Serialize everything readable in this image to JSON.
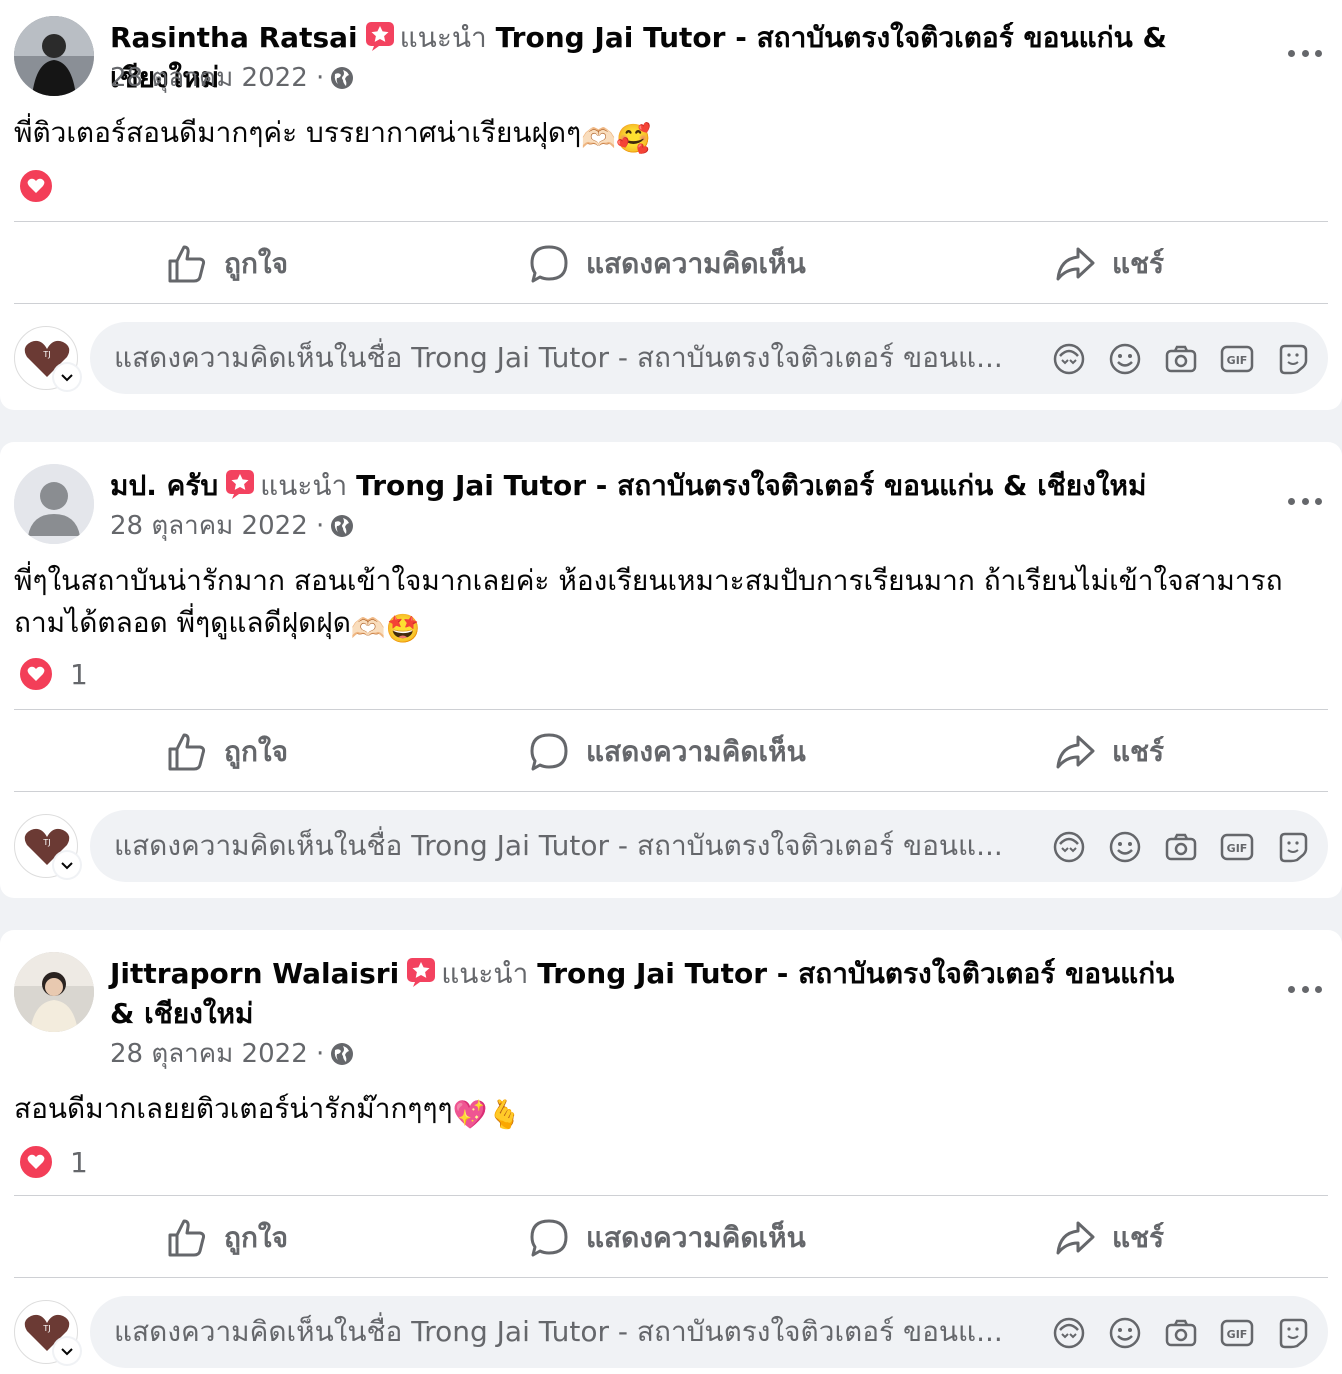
{
  "common": {
    "recommend_word": "แนะนำ",
    "page_name": "Trong Jai Tutor - สถาบันตรงใจติวเตอร์ ขอนแก่น & เชียงใหม่",
    "like_label": "ถูกใจ",
    "comment_label": "แสดงความคิดเห็น",
    "share_label": "แชร์",
    "comment_placeholder": "แสดงความคิดเห็นในชื่อ Trong Jai Tutor - สถาบันตรงใจติวเตอร์ ขอนแ...",
    "accent_love": "#f33e58",
    "icons": {
      "avatar_sticker": "avatar-sticker-icon",
      "emoji": "emoji-icon",
      "camera": "camera-icon",
      "gif": "gif-icon",
      "sticker": "sticker-icon"
    }
  },
  "posts": [
    {
      "author": "Rasintha Ratsai",
      "date": "28 ตุลาคม 2022 ·",
      "text": "พี่ติวเตอร์สอนดีมากๆค่ะ บรรยากาศน่าเรียนฝุดๆ",
      "emojis": [
        "🫶🏻",
        "🥰"
      ],
      "reaction_count": ""
    },
    {
      "author": "มป. ครับ",
      "date": "28 ตุลาคม 2022 ·",
      "text": "พี่ๆในสถาบันน่ารักมาก สอนเข้าใจมากเลยค่ะ ห้องเรียนเหมาะสมปับการเรียนมาก ถ้าเรียนไม่เข้าใจสามารถถามได้ตลอด พี่ๆดูแลดีฝุดฝุด",
      "emojis": [
        "🫶🏻",
        "🤩"
      ],
      "reaction_count": "1"
    },
    {
      "author": "Jittraporn Walaisri",
      "date": "28 ตุลาคม 2022 ·",
      "text": "สอนดีมากเลยยติวเตอร์น่ารักม๊ากๆๆๆ",
      "emojis": [
        "💖",
        "🫰"
      ],
      "reaction_count": "1"
    }
  ]
}
